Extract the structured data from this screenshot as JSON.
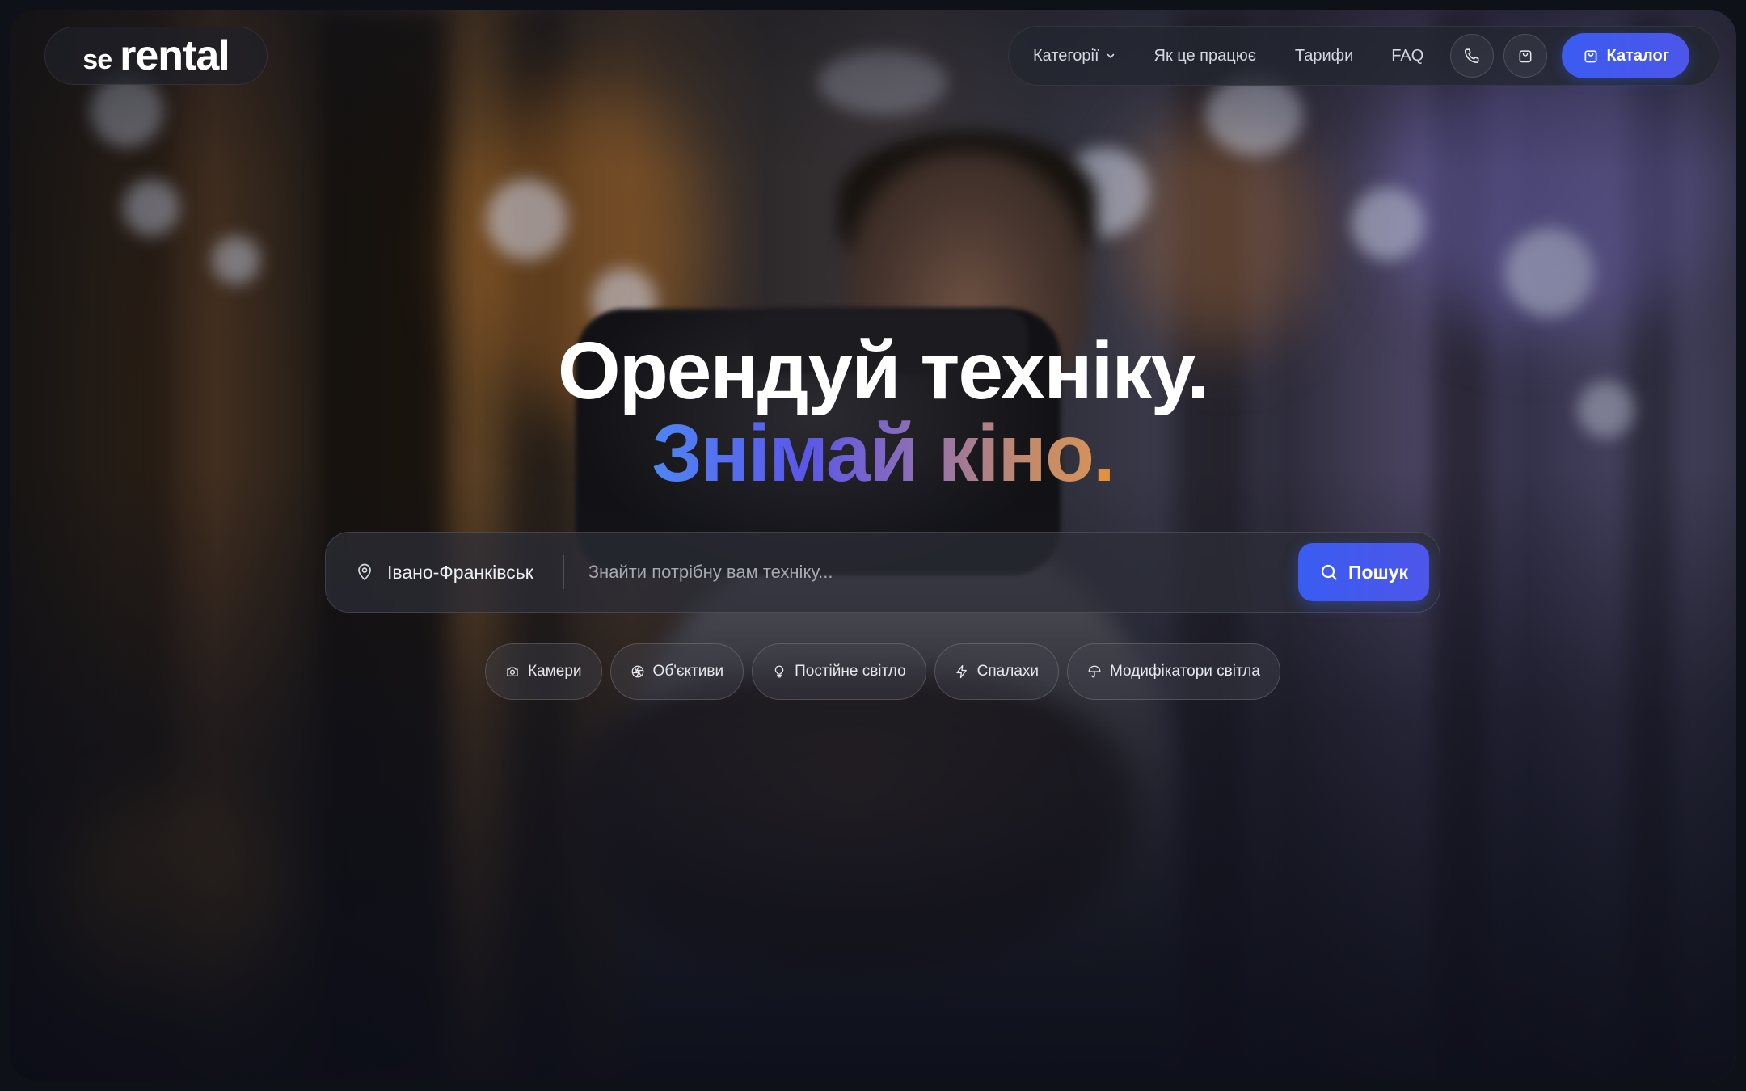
{
  "brand": {
    "prefix": "se",
    "name": "rental"
  },
  "nav": {
    "categories": "Категорії",
    "how_it_works": "Як це працює",
    "pricing": "Тарифи",
    "faq": "FAQ",
    "phone_icon": "phone-icon",
    "cart_icon": "shopping-bag-icon",
    "catalog": "Каталог"
  },
  "hero": {
    "line1": "Орендуй техніку.",
    "line2": "Знімай кіно",
    "line2_dot": "."
  },
  "search": {
    "city": "Івано-Франківськ",
    "placeholder": "Знайти потрібну вам техніку...",
    "button": "Пошук"
  },
  "chips": [
    {
      "label": "Камери",
      "icon": "camera-icon"
    },
    {
      "label": "Об'єктиви",
      "icon": "aperture-icon"
    },
    {
      "label": "Постійне світло",
      "icon": "lightbulb-icon"
    },
    {
      "label": "Спалахи",
      "icon": "lightning-icon"
    },
    {
      "label": "Модифікатори світла",
      "icon": "umbrella-icon"
    }
  ],
  "colors": {
    "accent": "#3a5cf1",
    "gradient_start": "#4f86f3",
    "gradient_end": "#d4925b",
    "dot": "#e2913f"
  }
}
